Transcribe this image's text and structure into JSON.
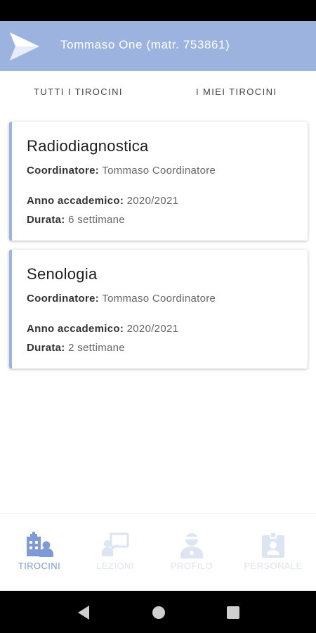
{
  "header": {
    "title": "Tommaso One (matr. 753861)"
  },
  "tabs": [
    {
      "label": "TUTTI I TIROCINI"
    },
    {
      "label": "I MIEI TIROCINI"
    }
  ],
  "cards": [
    {
      "title": "Radiodiagnostica",
      "coord_label": "Coordinatore:",
      "coord_value": "Tommaso Coordinatore",
      "anno_label": "Anno accademico:",
      "anno_value": "2020/2021",
      "durata_label": "Durata:",
      "durata_value": "6 settimane"
    },
    {
      "title": "Senologia",
      "coord_label": "Coordinatore:",
      "coord_value": "Tommaso Coordinatore",
      "anno_label": "Anno accademico:",
      "anno_value": "2020/2021",
      "durata_label": "Durata:",
      "durata_value": "2 settimane"
    }
  ],
  "bottom_nav": [
    {
      "label": "TIROCINI",
      "icon": "hospital-staff-icon",
      "active": true
    },
    {
      "label": "LEZIONI",
      "icon": "classroom-icon",
      "active": false
    },
    {
      "label": "PROFILO",
      "icon": "doctor-profile-icon",
      "active": false
    },
    {
      "label": "PERSONALE",
      "icon": "id-badge-icon",
      "active": false
    }
  ],
  "colors": {
    "accent": "#9db3df",
    "active_nav": "#7e9bd5",
    "inactive_nav": "#dde4f2"
  }
}
